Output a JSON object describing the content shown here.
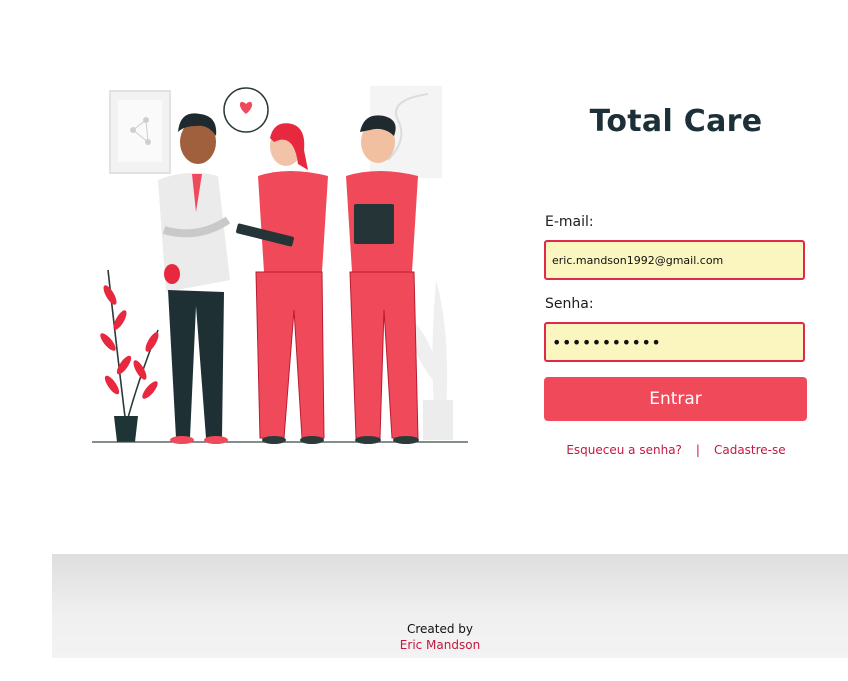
{
  "app": {
    "title": "Total Care"
  },
  "login": {
    "email_label": "E-mail:",
    "email_value": "eric.mandson1992@gmail.com",
    "password_label": "Senha:",
    "password_value": "•••••••••••",
    "submit_label": "Entrar",
    "forgot_link": "Esqueceu a senha?",
    "separator": "|",
    "signup_link": "Cadastre-se"
  },
  "footer": {
    "created_by": "Created by",
    "author": "Eric Mandson"
  },
  "colors": {
    "accent": "#f04a5a",
    "input_border": "#e0294a",
    "input_bg": "#fbf5bf",
    "link": "#c41840",
    "title": "#1c3038"
  },
  "illustration": {
    "subject": "doctor-and-two-nurses"
  }
}
